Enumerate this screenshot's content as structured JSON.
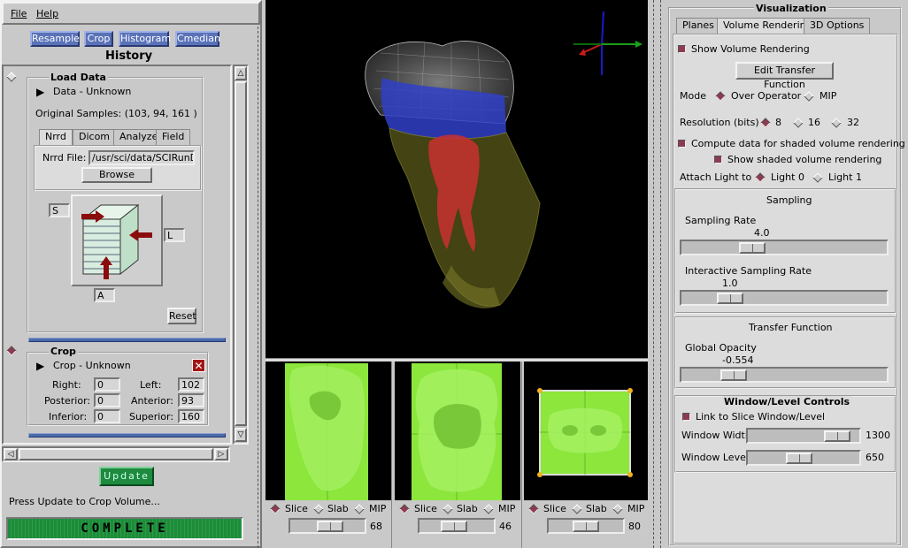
{
  "menu": {
    "file": "File",
    "help": "Help"
  },
  "toolbar": {
    "resample": "Resample",
    "crop": "Crop",
    "histogram": "Histogram",
    "cmedian": "Cmedian"
  },
  "history": {
    "title": "History",
    "load": {
      "title": "Load Data",
      "item": "Data - Unknown",
      "original_samples": "Original Samples: (103, 94, 161 )",
      "tabs": [
        "Nrrd",
        "Dicom",
        "Analyze",
        "Field"
      ],
      "nrrd_label": "Nrrd File:",
      "nrrd_value": "/usr/sci/data/SCIRunData",
      "browse": "Browse",
      "axis_s": "S",
      "axis_l": "L",
      "axis_a": "A",
      "reset": "Reset"
    },
    "crop": {
      "title": "Crop",
      "item": "Crop - Unknown",
      "right_label": "Right:",
      "right": "0",
      "left_label": "Left:",
      "left": "102",
      "posterior_label": "Posterior:",
      "posterior": "0",
      "anterior_label": "Anterior:",
      "anterior": "93",
      "inferior_label": "Inferior:",
      "inferior": "0",
      "superior_label": "Superior:",
      "superior": "160"
    }
  },
  "update_button": "Update",
  "status_text": "Press Update to Crop Volume...",
  "progress": {
    "label": "COMPLETE",
    "fraction": 1.0
  },
  "slices": [
    {
      "options": [
        "Slice",
        "Slab",
        "MIP"
      ],
      "selected": "Slice",
      "value": "68",
      "fraction": 0.55
    },
    {
      "options": [
        "Slice",
        "Slab",
        "MIP"
      ],
      "selected": "Slice",
      "value": "46",
      "fraction": 0.45
    },
    {
      "options": [
        "Slice",
        "Slab",
        "MIP"
      ],
      "selected": "Slice",
      "value": "80",
      "fraction": 0.5
    }
  ],
  "vis": {
    "title": "Visualization",
    "tabs": [
      "Planes",
      "Volume Rendering",
      "3D Options"
    ],
    "active_tab": "Volume Rendering",
    "show_volume": "Show Volume Rendering",
    "edit_tf": "Edit Transfer Function",
    "mode_label": "Mode",
    "mode_over": "Over Operator",
    "mode_mip": "MIP",
    "mode_selected": "Over Operator",
    "res_label": "Resolution (bits)",
    "res_options": [
      "8",
      "16",
      "32"
    ],
    "res_selected": "8",
    "compute_shaded": "Compute data for shaded volume rendering",
    "show_shaded": "Show shaded volume rendering",
    "attach_label": "Attach Light to",
    "light0": "Light 0",
    "light1": "Light 1",
    "light_selected": "Light 0",
    "sampling_title": "Sampling",
    "sampling_rate_label": "Sampling Rate",
    "sampling_rate": "4.0",
    "sampling_fraction": 0.32,
    "interactive_label": "Interactive Sampling Rate",
    "interactive_rate": "1.0",
    "interactive_fraction": 0.2,
    "tf_title": "Transfer Function",
    "opacity_label": "Global Opacity",
    "opacity": "-0.554",
    "opacity_fraction": 0.22,
    "wl_title": "Window/Level Controls",
    "link_slice": "Link to Slice Window/Level",
    "ww_label": "Window Width",
    "ww_value": "1300",
    "ww_fraction": 0.9,
    "wlev_label": "Window Level",
    "wlev_value": "650",
    "wlev_fraction": 0.45
  },
  "colors": {
    "accent_blue": "#5a72b8",
    "progress_green": "#1f8a3a",
    "checked": "#8c3b50",
    "slice_green": "#8ce63c"
  }
}
